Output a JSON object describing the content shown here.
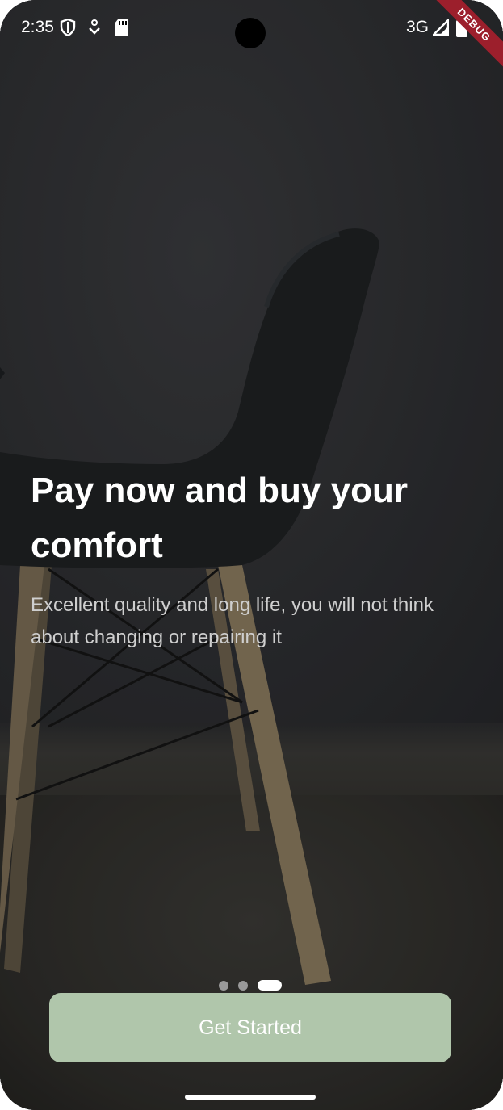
{
  "status_bar": {
    "time": "2:35",
    "network": "3G",
    "icons": [
      "shield-icon",
      "download-icon",
      "sd-card-icon",
      "signal-icon",
      "battery-icon"
    ],
    "debug_banner": "DEBUG"
  },
  "onboarding": {
    "title": "Pay now and buy your comfort",
    "subtitle": "Excellent quality and long life, you will not think about changing or repairing it",
    "page_indicator": {
      "count": 3,
      "active_index": 2
    },
    "cta_label": "Get Started"
  },
  "colors": {
    "button_bg": "#b0c6ab",
    "debug_banner": "#9c1f2c",
    "subtitle": "#cfcfcf"
  }
}
